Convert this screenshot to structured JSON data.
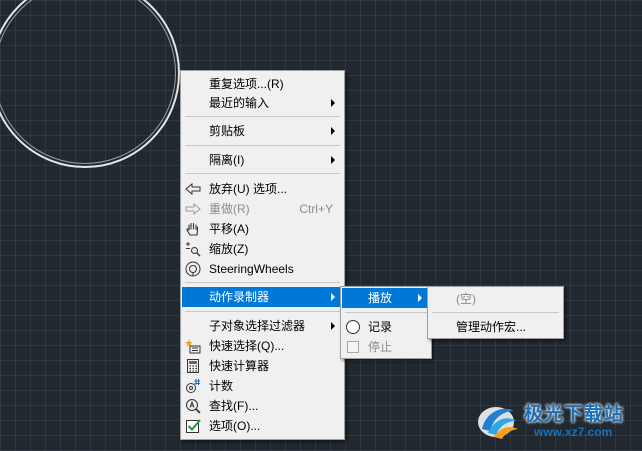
{
  "context_menu": {
    "items": [
      {
        "label": "重复选项...(R)"
      },
      {
        "label": "最近的输入"
      },
      {
        "label": "剪贴板"
      },
      {
        "label": "隔离(I)"
      },
      {
        "label": "放弃(U) 选项..."
      },
      {
        "label": "重做(R)",
        "shortcut": "Ctrl+Y"
      },
      {
        "label": "平移(A)"
      },
      {
        "label": "缩放(Z)"
      },
      {
        "label": "SteeringWheels"
      },
      {
        "label": "动作录制器"
      },
      {
        "label": "子对象选择过滤器"
      },
      {
        "label": "快速选择(Q)..."
      },
      {
        "label": "快速计算器"
      },
      {
        "label": "计数"
      },
      {
        "label": "查找(F)..."
      },
      {
        "label": "选项(O)..."
      }
    ]
  },
  "action_recorder_menu": {
    "items": [
      {
        "label": "播放"
      },
      {
        "label": "记录"
      },
      {
        "label": "停止"
      }
    ]
  },
  "macro_menu": {
    "items": [
      {
        "label": "(空)"
      },
      {
        "label": "管理动作宏..."
      }
    ]
  },
  "watermark": {
    "title": "极光下载站",
    "url": "www.xz7.com"
  },
  "colors": {
    "canvas_background": "#212830",
    "menu_background": "#f0f0f0",
    "selection": "#0078d7",
    "disabled_text": "#8c8c8c",
    "watermark": "#1a6fb8"
  }
}
